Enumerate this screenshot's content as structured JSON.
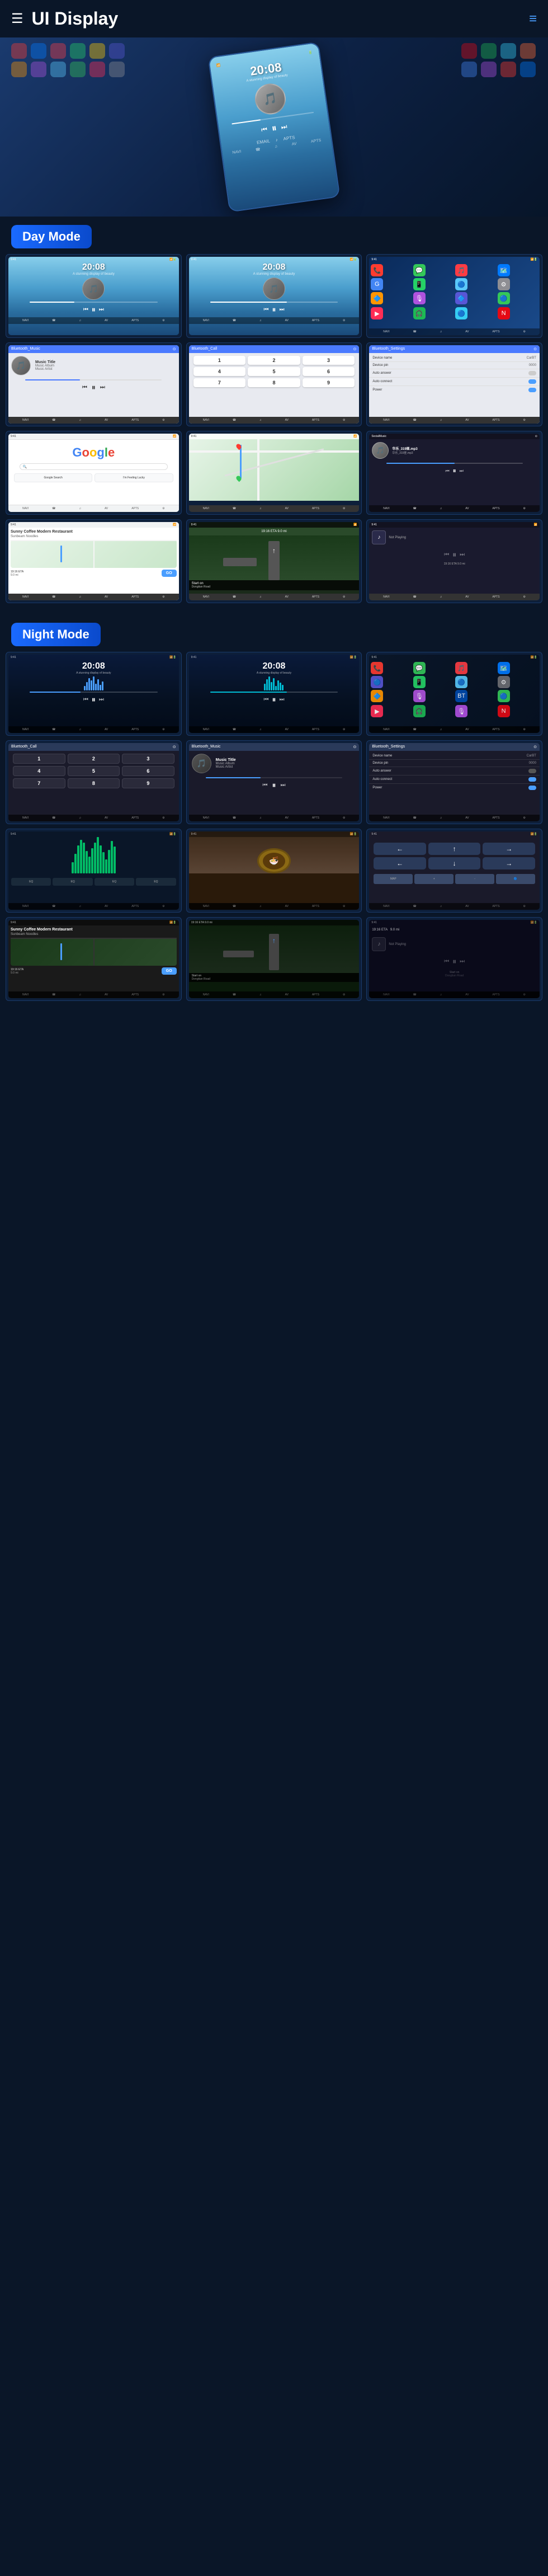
{
  "header": {
    "title": "UI Display",
    "menu_icon": "☰",
    "nav_icon": "≡"
  },
  "hero": {
    "time": "20:08",
    "subtitle": "A stunning display of beauty"
  },
  "day_mode": {
    "label": "Day Mode"
  },
  "night_mode": {
    "label": "Night Mode"
  },
  "screens": {
    "music_time": "20:08",
    "music_date": "A stunning display of beauty",
    "music_title": "Music Title",
    "music_album": "Music Album",
    "music_artist": "Music Artist",
    "bluetooth_music": "Bluetooth_Music",
    "bluetooth_call": "Bluetooth_Call",
    "bluetooth_settings": "Bluetooth_Settings",
    "device_name_label": "Device name",
    "device_name_value": "CarBT",
    "device_pin_label": "Device pin",
    "device_pin_value": "0000",
    "auto_answer_label": "Auto answer",
    "auto_connect_label": "Auto connect",
    "power_label": "Power",
    "google_text": "Google",
    "social_music": "SocialMusic",
    "sunny_coffee": "Sunny Coffee Modern Restaurant",
    "sunny_address": "Sunbeam Noodles",
    "coffee_go": "GO",
    "not_playing": "Not Playing",
    "start_on": "Start on",
    "dongtian_road": "Dongtian Road",
    "eta_label": "19:16 ETA",
    "distance": "9.0 mi",
    "music_filename1": "华乐_319匪.mp3",
    "music_filename2": "华乐_319匪.mp3"
  },
  "nav_items": {
    "items": [
      "NAVI",
      "☎",
      "♫",
      "AV",
      "APTS",
      "⚙"
    ],
    "day_items": [
      "NAVI",
      "☎",
      "♫",
      "AV",
      "APTS",
      "⚙"
    ],
    "night_items": [
      "NAVI",
      "☎",
      "♫",
      "AV",
      "APTS",
      "⚙"
    ]
  },
  "app_colors": {
    "phone": "#ff3b30",
    "messages": "#34c759",
    "music": "#fc3c44",
    "maps": "#007aff",
    "camera": "#8e8e93",
    "settings": "#8e8e93",
    "whatsapp": "#25d366",
    "youtube": "#ff0000",
    "podcasts": "#b150e2",
    "netflix": "#e50914",
    "spotify": "#1db954",
    "waze": "#35cdf4"
  },
  "colors": {
    "accent": "#1a6aff",
    "background": "#0a1628",
    "card": "#0d1f3a",
    "border": "#1a3a6a"
  }
}
